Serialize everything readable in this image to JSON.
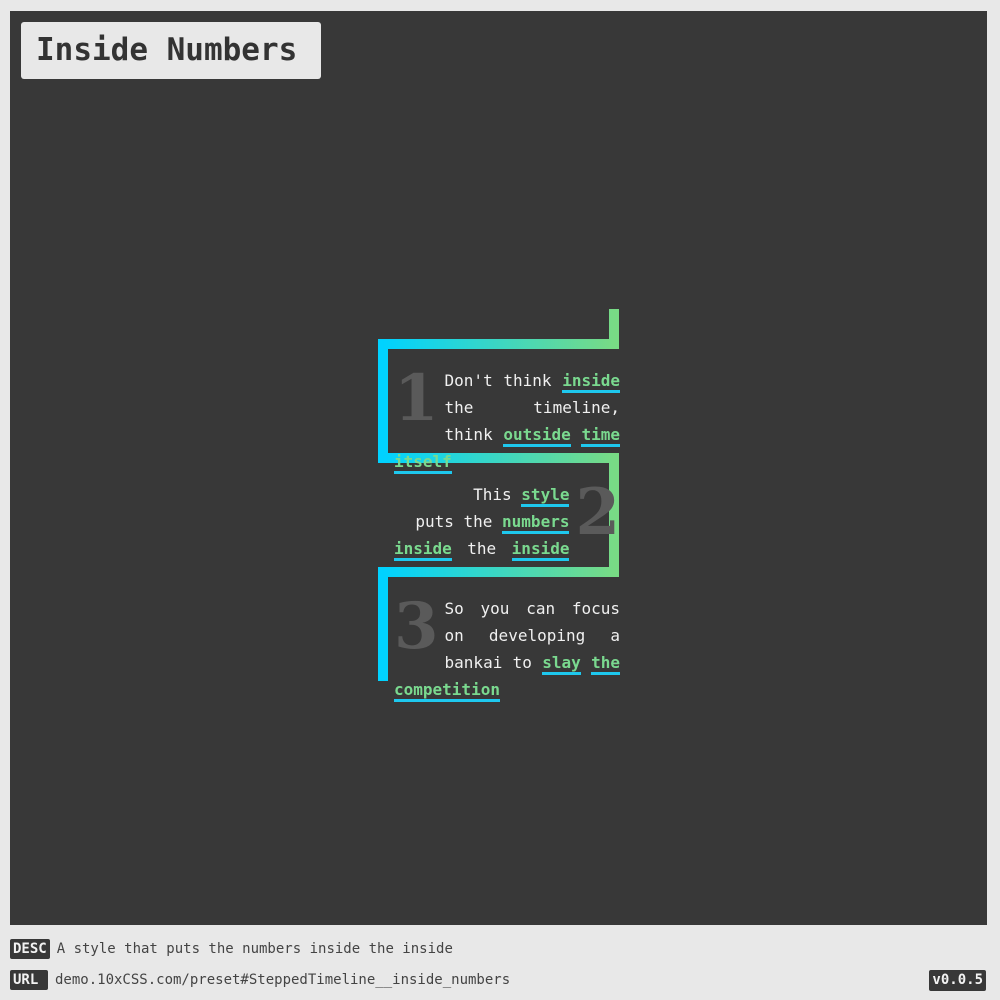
{
  "title": "Inside Numbers",
  "colors": {
    "panel_bg": "#383838",
    "page_bg": "#e8e8e8",
    "gradient_start": "#00d2ff",
    "gradient_end": "#78db85",
    "number_color": "#5a5a5a",
    "highlight_text": "#7ad98f",
    "highlight_underline": "#1ec8ee"
  },
  "steps": [
    {
      "number": "1",
      "lines": [
        [
          "Don't think ",
          "inside"
        ],
        [
          "the timeline, think"
        ],
        [
          "outside",
          " ",
          "time",
          " ",
          "itself"
        ]
      ],
      "plain_1a": "Don't think",
      "hl_1a": "inside",
      "plain_1b": "the timeline, think",
      "hl_1c": "outside",
      "hl_1d": "time",
      "hl_1e": "itself"
    },
    {
      "number": "2",
      "plain_2a": "This",
      "hl_2a": "style",
      "plain_2b": "puts the",
      "hl_2b": "numbers",
      "hl_2c": "inside",
      "plain_2c": "the",
      "hl_2d": "inside"
    },
    {
      "number": "3",
      "plain_3a": "So you can focus on",
      "plain_3b": "developing a bankai",
      "plain_3c": "to",
      "hl_3a": "slay",
      "hl_3b": "the",
      "hl_3c": "competition"
    }
  ],
  "footer": {
    "desc_tag": "DESC",
    "desc_text": "A style that puts the numbers inside the inside",
    "url_tag": "URL",
    "url_text": "demo.10xCSS.com/preset#SteppedTimeline__inside_numbers",
    "version": "v0.0.5"
  }
}
